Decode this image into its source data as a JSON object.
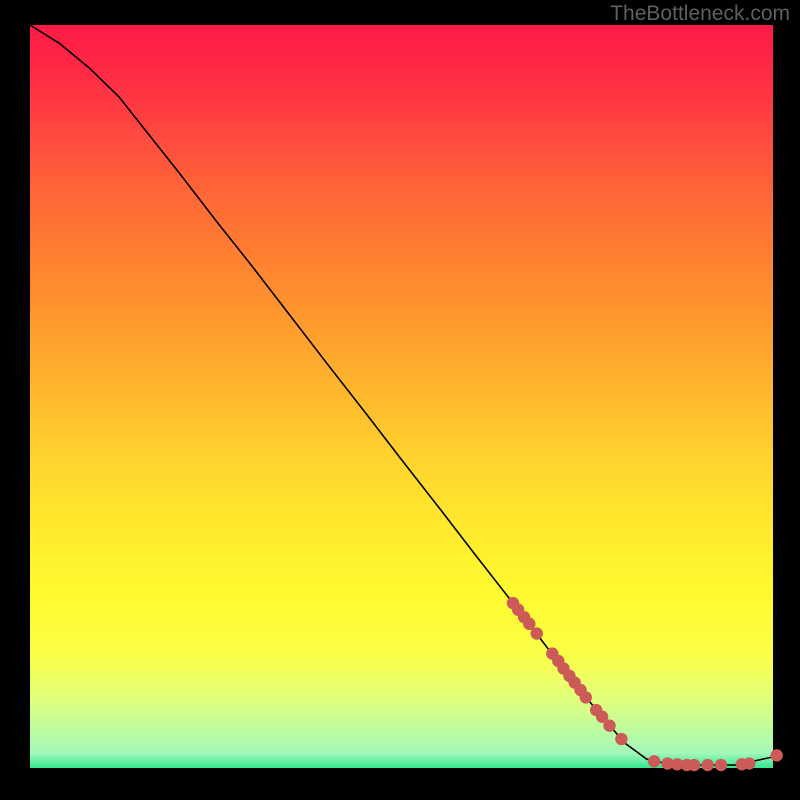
{
  "watermark": "TheBottleneck.com",
  "chart_data": {
    "type": "line",
    "title": "",
    "xlabel": "",
    "ylabel": "",
    "xlim": [
      0,
      100
    ],
    "ylim": [
      0,
      100
    ],
    "grid": false,
    "legend": false,
    "line": [
      {
        "x": 0.0,
        "y": 100.0
      },
      {
        "x": 4.0,
        "y": 97.5
      },
      {
        "x": 8.0,
        "y": 94.2
      },
      {
        "x": 12.0,
        "y": 90.3
      },
      {
        "x": 15.0,
        "y": 86.5
      },
      {
        "x": 20.0,
        "y": 80.2
      },
      {
        "x": 25.0,
        "y": 73.7
      },
      {
        "x": 30.0,
        "y": 67.4
      },
      {
        "x": 35.0,
        "y": 60.9
      },
      {
        "x": 40.0,
        "y": 54.4
      },
      {
        "x": 45.0,
        "y": 48.0
      },
      {
        "x": 50.0,
        "y": 41.5
      },
      {
        "x": 55.0,
        "y": 35.1
      },
      {
        "x": 60.0,
        "y": 28.6
      },
      {
        "x": 65.0,
        "y": 22.2
      },
      {
        "x": 70.0,
        "y": 15.7
      },
      {
        "x": 75.0,
        "y": 9.3
      },
      {
        "x": 80.0,
        "y": 3.4
      },
      {
        "x": 83.0,
        "y": 1.2
      },
      {
        "x": 86.0,
        "y": 0.5
      },
      {
        "x": 90.0,
        "y": 0.4
      },
      {
        "x": 95.0,
        "y": 0.4
      },
      {
        "x": 100.0,
        "y": 1.5
      }
    ],
    "markers": [
      {
        "x": 65.0,
        "y": 22.2
      },
      {
        "x": 65.7,
        "y": 21.3
      },
      {
        "x": 66.5,
        "y": 20.3
      },
      {
        "x": 67.2,
        "y": 19.4
      },
      {
        "x": 68.2,
        "y": 18.1
      },
      {
        "x": 70.3,
        "y": 15.4
      },
      {
        "x": 71.1,
        "y": 14.4
      },
      {
        "x": 71.8,
        "y": 13.4
      },
      {
        "x": 72.6,
        "y": 12.4
      },
      {
        "x": 73.3,
        "y": 11.5
      },
      {
        "x": 74.1,
        "y": 10.5
      },
      {
        "x": 74.8,
        "y": 9.5
      },
      {
        "x": 76.2,
        "y": 7.8
      },
      {
        "x": 77.0,
        "y": 6.9
      },
      {
        "x": 78.0,
        "y": 5.7
      },
      {
        "x": 79.6,
        "y": 3.9
      },
      {
        "x": 84.0,
        "y": 0.9
      },
      {
        "x": 85.8,
        "y": 0.6
      },
      {
        "x": 87.1,
        "y": 0.5
      },
      {
        "x": 88.4,
        "y": 0.4
      },
      {
        "x": 89.4,
        "y": 0.4
      },
      {
        "x": 91.2,
        "y": 0.4
      },
      {
        "x": 93.0,
        "y": 0.4
      },
      {
        "x": 95.8,
        "y": 0.5
      },
      {
        "x": 96.8,
        "y": 0.6
      },
      {
        "x": 100.5,
        "y": 1.7
      }
    ],
    "marker_color": "#cc5a57",
    "line_color": "#000000"
  }
}
